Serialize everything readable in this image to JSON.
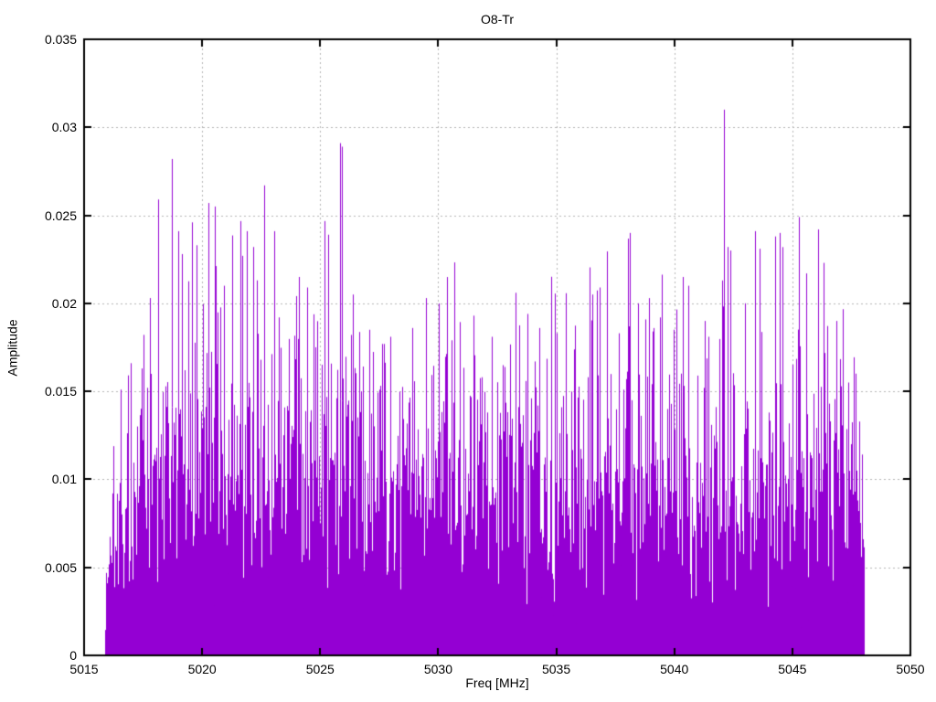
{
  "chart": {
    "title": "O8-Tr",
    "xlabel": "Freq [MHz]",
    "ylabel": "Amplitude"
  },
  "chart_data": {
    "type": "line",
    "style": "impulses",
    "title": "O8-Tr",
    "xlabel": "Freq [MHz]",
    "ylabel": "Amplitude",
    "xlim": [
      5015,
      5050
    ],
    "ylim": [
      0,
      0.035
    ],
    "x_ticks": [
      5015,
      5020,
      5025,
      5030,
      5035,
      5040,
      5045,
      5050
    ],
    "x_tick_labels": [
      "5015",
      "5020",
      "5025",
      "5030",
      "5035",
      "5040",
      "5045",
      "5050"
    ],
    "y_ticks": [
      0,
      0.005,
      0.01,
      0.015,
      0.02,
      0.025,
      0.03,
      0.035
    ],
    "y_tick_labels": [
      "0",
      "0.005",
      "0.01",
      "0.015",
      "0.02",
      "0.025",
      "0.03",
      "0.035"
    ],
    "grid": true,
    "legend": "none",
    "series_color": "#9400d3",
    "grid_color": "#b4b4b4",
    "border_color": "#000000",
    "data_range": [
      5015.92,
      5048.05
    ],
    "noise": {
      "model": "rayleigh-impulses",
      "seed": 1337,
      "count": 1660,
      "sigma": 0.0066,
      "floor": 0.0006,
      "cap": 0.0235,
      "envelope": [
        [
          5015.92,
          0.3
        ],
        [
          5016.15,
          0.72
        ],
        [
          5016.6,
          0.88
        ],
        [
          5017.3,
          1.0
        ],
        [
          5018.0,
          1.05
        ],
        [
          5026.0,
          1.05
        ],
        [
          5028.0,
          0.95
        ],
        [
          5032.5,
          0.95
        ],
        [
          5034.5,
          1.0
        ],
        [
          5044.0,
          1.02
        ],
        [
          5046.0,
          1.05
        ],
        [
          5047.3,
          1.0
        ],
        [
          5047.75,
          0.82
        ],
        [
          5048.05,
          0.5
        ]
      ]
    },
    "peaks": [
      [
        5016.55,
        0.0151
      ],
      [
        5017.0,
        0.0166
      ],
      [
        5017.45,
        0.0163
      ],
      [
        5017.79,
        0.0203
      ],
      [
        5018.17,
        0.0259
      ],
      [
        5018.72,
        0.0282
      ],
      [
        5018.99,
        0.0241
      ],
      [
        5019.18,
        0.0228
      ],
      [
        5019.57,
        0.0246
      ],
      [
        5019.8,
        0.0233
      ],
      [
        5020.3,
        0.0257
      ],
      [
        5020.54,
        0.0255
      ],
      [
        5020.95,
        0.021
      ],
      [
        5021.3,
        0.0209
      ],
      [
        5021.7,
        0.0227
      ],
      [
        5021.93,
        0.0241
      ],
      [
        5022.2,
        0.0232
      ],
      [
        5022.63,
        0.0267
      ],
      [
        5023.09,
        0.0241
      ],
      [
        5023.28,
        0.0192
      ],
      [
        5024.1,
        0.0215
      ],
      [
        5024.48,
        0.0209
      ],
      [
        5025.34,
        0.0239
      ],
      [
        5025.85,
        0.0291
      ],
      [
        5025.95,
        0.0289
      ],
      [
        5026.4,
        0.0205
      ],
      [
        5027.1,
        0.0185
      ],
      [
        5028.0,
        0.0181
      ],
      [
        5028.9,
        0.0186
      ],
      [
        5029.5,
        0.0203
      ],
      [
        5030.6,
        0.0179
      ],
      [
        5031.5,
        0.0193
      ],
      [
        5032.3,
        0.0181
      ],
      [
        5033.31,
        0.0206
      ],
      [
        5033.8,
        0.0194
      ],
      [
        5034.3,
        0.0186
      ],
      [
        5035.05,
        0.0183
      ],
      [
        5035.8,
        0.0182
      ],
      [
        5036.56,
        0.0205
      ],
      [
        5036.87,
        0.0209
      ],
      [
        5037.65,
        0.0183
      ],
      [
        5038.15,
        0.024
      ],
      [
        5038.5,
        0.02
      ],
      [
        5039.1,
        0.0184
      ],
      [
        5039.4,
        0.0192
      ],
      [
        5040.36,
        0.0215
      ],
      [
        5040.6,
        0.021
      ],
      [
        5041.3,
        0.019
      ],
      [
        5042.06,
        0.0213
      ],
      [
        5042.14,
        0.031
      ],
      [
        5042.26,
        0.0232
      ],
      [
        5042.4,
        0.023
      ],
      [
        5043.0,
        0.02
      ],
      [
        5043.45,
        0.0241
      ],
      [
        5043.65,
        0.0231
      ],
      [
        5044.27,
        0.0238
      ],
      [
        5044.5,
        0.024
      ],
      [
        5045.3,
        0.0249
      ],
      [
        5045.6,
        0.0217
      ],
      [
        5046.1,
        0.0242
      ],
      [
        5046.35,
        0.0223
      ],
      [
        5046.9,
        0.019
      ],
      [
        5047.4,
        0.0155
      ]
    ]
  }
}
